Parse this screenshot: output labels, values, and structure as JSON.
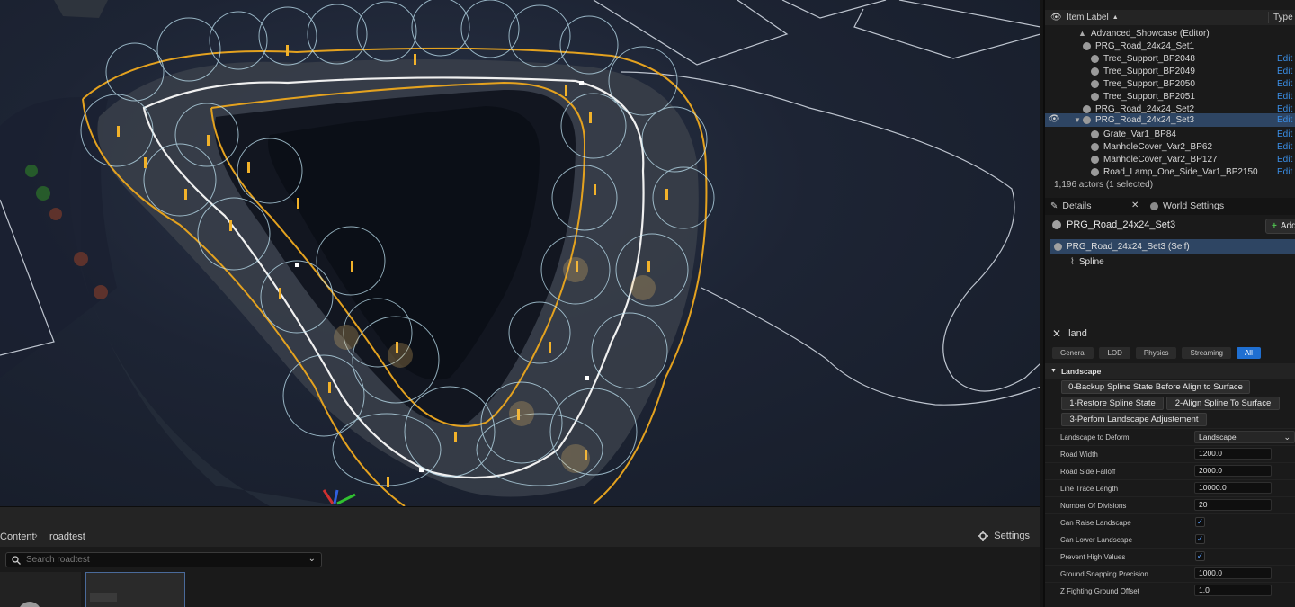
{
  "content_browser": {
    "path_root": "Content",
    "path_folder": "roadtest",
    "settings_label": "Settings",
    "search_placeholder": "Search roadtest"
  },
  "outliner": {
    "col_label": "Item Label",
    "col_type": "Type",
    "rows": [
      {
        "label": "Advanced_Showcase (Editor)",
        "edit": ""
      },
      {
        "label": "PRG_Road_24x24_Set1",
        "edit": ""
      },
      {
        "label": "Tree_Support_BP2048",
        "edit": "Edit T"
      },
      {
        "label": "Tree_Support_BP2049",
        "edit": "Edit T"
      },
      {
        "label": "Tree_Support_BP2050",
        "edit": "Edit T"
      },
      {
        "label": "Tree_Support_BP2051",
        "edit": "Edit T"
      },
      {
        "label": "PRG_Road_24x24_Set2",
        "edit": "Edit P"
      },
      {
        "label": "PRG_Road_24x24_Set3",
        "edit": "Edit P"
      },
      {
        "label": "Grate_Var1_BP84",
        "edit": "Edit G"
      },
      {
        "label": "ManholeCover_Var2_BP62",
        "edit": "Edit M"
      },
      {
        "label": "ManholeCover_Var2_BP127",
        "edit": "Edit M"
      },
      {
        "label": "Road_Lamp_One_Side_Var1_BP2150",
        "edit": "Edit R"
      }
    ],
    "actor_count": "1,196 actors (1 selected)"
  },
  "details": {
    "tab_details": "Details",
    "tab_world": "World Settings",
    "selected_actor": "PRG_Road_24x24_Set3",
    "add_label": "Add",
    "components": [
      "PRG_Road_24x24_Set3 (Self)",
      "Spline"
    ],
    "search_value": "land",
    "filters": [
      "General",
      "LOD",
      "Physics",
      "Streaming",
      "All"
    ],
    "section": "Landscape",
    "buttons": {
      "backup": "0-Backup Spline State Before Align to Surface",
      "restore": "1-Restore Spline State",
      "align": "2-Align Spline To Surface",
      "adjust": "3-Perfom Landscape Adjustement"
    },
    "props": {
      "deform_label": "Landscape to Deform",
      "deform_value": "Landscape",
      "width_label": "Road Width",
      "width_value": "1200.0",
      "falloff_label": "Road Side Falloff",
      "falloff_value": "2000.0",
      "trace_label": "Line Trace Length",
      "trace_value": "10000.0",
      "divisions_label": "Number Of Divisions",
      "divisions_value": "20",
      "raise_label": "Can Raise Landscape",
      "lower_label": "Can Lower Landscape",
      "prevent_label": "Prevent High Values",
      "snap_label": "Ground Snapping Precision",
      "snap_value": "1000.0",
      "zfight_label": "Z Fighting Ground Offset",
      "zfight_value": "1.0"
    }
  }
}
